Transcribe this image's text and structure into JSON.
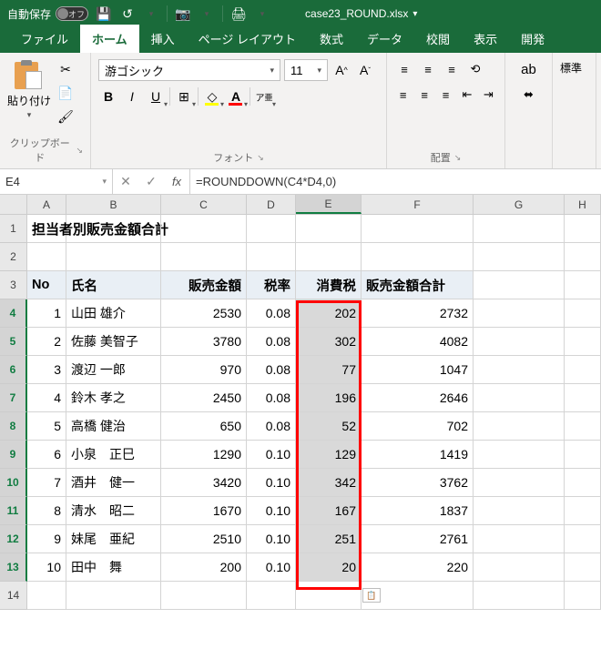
{
  "titlebar": {
    "autosave_label": "自動保存",
    "toggle_text": "オフ",
    "filename": "case23_ROUND.xlsx"
  },
  "tabs": {
    "file": "ファイル",
    "home": "ホーム",
    "insert": "挿入",
    "pagelayout": "ページ レイアウト",
    "formulas": "数式",
    "data": "データ",
    "review": "校閲",
    "view": "表示",
    "dev": "開発"
  },
  "ribbon": {
    "paste_label": "貼り付け",
    "clipboard_label": "クリップボード",
    "font_name": "游ゴシック",
    "font_size": "11",
    "font_label": "フォント",
    "align_label": "配置",
    "num_label": "標準"
  },
  "formula_bar": {
    "cell_ref": "E4",
    "formula": "=ROUNDDOWN(C4*D4,0)"
  },
  "grid": {
    "title": "担当者別販売金額合計",
    "headers": {
      "no": "No",
      "name": "氏名",
      "sales": "販売金額",
      "rate": "税率",
      "tax": "消費税",
      "total": "販売金額合計"
    },
    "rows": [
      {
        "no": "1",
        "name": "山田 雄介",
        "sales": "2530",
        "rate": "0.08",
        "tax": "202",
        "total": "2732"
      },
      {
        "no": "2",
        "name": "佐藤 美智子",
        "sales": "3780",
        "rate": "0.08",
        "tax": "302",
        "total": "4082"
      },
      {
        "no": "3",
        "name": "渡辺 一郎",
        "sales": "970",
        "rate": "0.08",
        "tax": "77",
        "total": "1047"
      },
      {
        "no": "4",
        "name": "鈴木 孝之",
        "sales": "2450",
        "rate": "0.08",
        "tax": "196",
        "total": "2646"
      },
      {
        "no": "5",
        "name": "高橋 健治",
        "sales": "650",
        "rate": "0.08",
        "tax": "52",
        "total": "702"
      },
      {
        "no": "6",
        "name": "小泉　正巳",
        "sales": "1290",
        "rate": "0.10",
        "tax": "129",
        "total": "1419"
      },
      {
        "no": "7",
        "name": "酒井　健一",
        "sales": "3420",
        "rate": "0.10",
        "tax": "342",
        "total": "3762"
      },
      {
        "no": "8",
        "name": "清水　昭二",
        "sales": "1670",
        "rate": "0.10",
        "tax": "167",
        "total": "1837"
      },
      {
        "no": "9",
        "name": "妹尾　亜紀",
        "sales": "2510",
        "rate": "0.10",
        "tax": "251",
        "total": "2761"
      },
      {
        "no": "10",
        "name": "田中　舞",
        "sales": "200",
        "rate": "0.10",
        "tax": "20",
        "total": "220"
      }
    ]
  }
}
